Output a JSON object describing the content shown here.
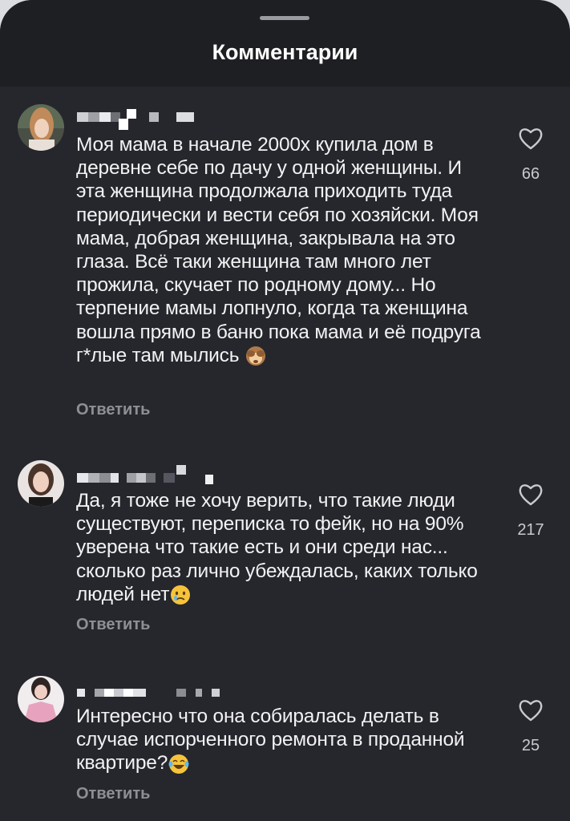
{
  "header": {
    "title": "Комментарии"
  },
  "comments": [
    {
      "text": "Моя мама в начале 2000х купила дом в деревне себе по дачу у одной женщины. И эта женщина продолжала приходить туда периодически и вести себя по хозяйски. Моя мама, добрая женщина, закрывала на это глаза. Всё таки женщина там много лет прожила, скучает по родному дому... Но терпение мамы лопнуло, когда та женщина вошла прямо в баню пока мама и её подруга г*лые там мылись",
      "emoji": "see-no-evil-monkey",
      "likes": "66",
      "reply": "Ответить"
    },
    {
      "text": "Да, я тоже не хочу верить, что такие люди существуют, переписка то фейк, но на 90% уверена что такие есть и они среди нас... сколько раз лично убеждалась, каких только людей нет",
      "emoji": "crying-face",
      "likes": "217",
      "reply": "Ответить"
    },
    {
      "text": "Интересно что она собиралась делать в случае испорченного ремонта в проданной квартире?",
      "emoji": "tears-of-joy",
      "likes": "25",
      "reply": "Ответить"
    }
  ],
  "colors": {
    "background": "#26272c",
    "header": "#1e1f23",
    "text": "#f2f2f4",
    "muted": "#8e8f96"
  }
}
